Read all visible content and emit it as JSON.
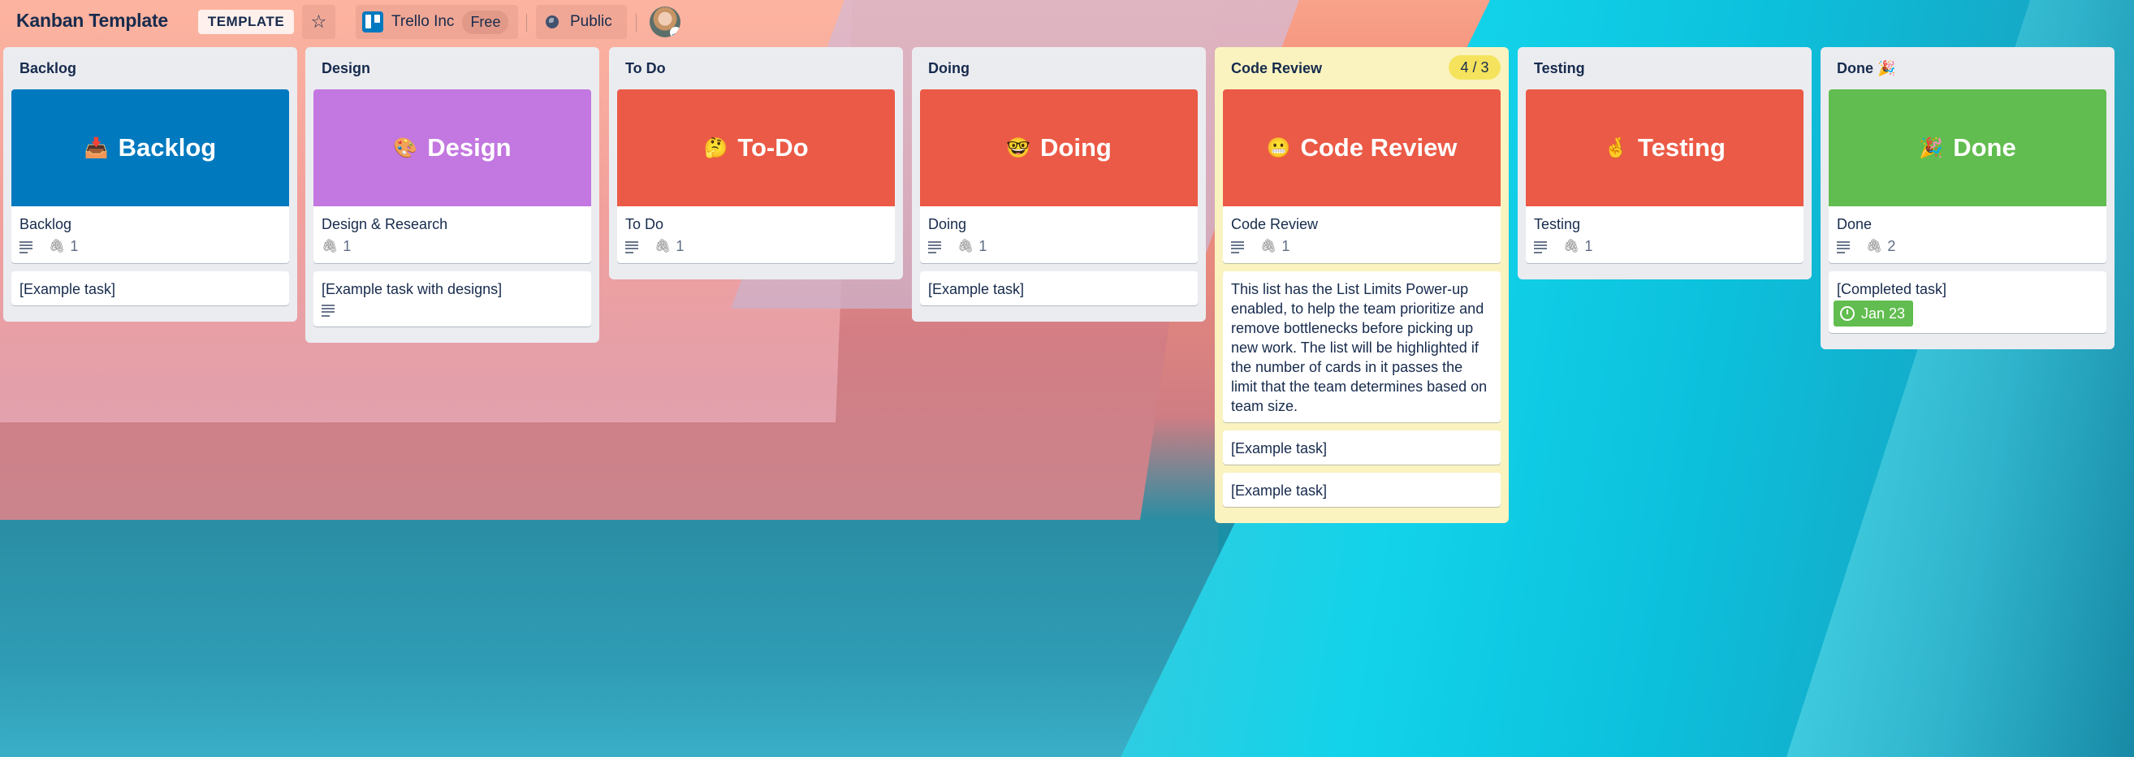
{
  "header": {
    "board_title": "Kanban Template",
    "template_badge": "TEMPLATE",
    "star_icon": "☆",
    "workspace_name": "Trello Inc",
    "workspace_plan": "Free",
    "visibility": "Public"
  },
  "colors": {
    "blue": "#0079bf",
    "purple": "#c377e0",
    "red": "#eb5a46",
    "green": "#61bd4f",
    "list_bg": "#ebecf0",
    "limit_list_bg": "#faf3c0",
    "limit_badge": "#f5e35d",
    "text": "#172b4d"
  },
  "lists": [
    {
      "name": "Backlog",
      "cover": {
        "emoji": "📥",
        "text": "Backlog",
        "color": "#0079bf"
      },
      "cover_card": {
        "title": "Backlog",
        "has_description": true,
        "attachments": "1"
      },
      "cards": [
        {
          "title": "[Example task]"
        }
      ]
    },
    {
      "name": "Design",
      "cover": {
        "emoji": "🎨",
        "text": "Design",
        "color": "#c377e0"
      },
      "cover_card": {
        "title": "Design & Research",
        "has_description": false,
        "attachments": "1"
      },
      "cards": [
        {
          "title": "[Example task with designs]",
          "has_description": true
        }
      ]
    },
    {
      "name": "To Do",
      "cover": {
        "emoji": "🤔",
        "text": "To-Do",
        "color": "#eb5a46"
      },
      "cover_card": {
        "title": "To Do",
        "has_description": true,
        "attachments": "1"
      },
      "cards": []
    },
    {
      "name": "Doing",
      "cover": {
        "emoji": "🤓",
        "text": "Doing",
        "color": "#eb5a46"
      },
      "cover_card": {
        "title": "Doing",
        "has_description": true,
        "attachments": "1"
      },
      "cards": [
        {
          "title": "[Example task]"
        }
      ]
    },
    {
      "name": "Code Review",
      "limit": "4 / 3",
      "cover": {
        "emoji": "😬",
        "text": "Code Review",
        "color": "#eb5a46"
      },
      "cover_card": {
        "title": "Code Review",
        "has_description": true,
        "attachments": "1"
      },
      "cards": [
        {
          "title": "This list has the List Limits Power-up enabled, to help the team prioritize and remove bottlenecks before picking up new work. The list will be highlighted if the number of cards in it passes the limit that the team determines based on team size."
        },
        {
          "title": "[Example task]"
        },
        {
          "title": "[Example task]"
        }
      ]
    },
    {
      "name": "Testing",
      "cover": {
        "emoji": "🤞",
        "text": "Testing",
        "color": "#eb5a46"
      },
      "cover_card": {
        "title": "Testing",
        "has_description": true,
        "attachments": "1"
      },
      "cards": []
    },
    {
      "name": "Done 🎉",
      "cover": {
        "emoji": "🎉",
        "text": "Done",
        "color": "#61bd4f"
      },
      "cover_card": {
        "title": "Done",
        "has_description": true,
        "attachments": "2"
      },
      "cards": [
        {
          "title": "[Completed task]",
          "due": "Jan 23"
        }
      ]
    }
  ]
}
